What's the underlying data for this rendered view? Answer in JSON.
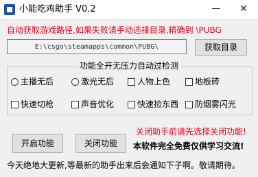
{
  "window": {
    "title": "小能吃鸡助手 V0.2",
    "minimize_glyph": "—",
    "close_glyph": "✕",
    "icon": "app-icon"
  },
  "hint_text": "自动获取游戏路径,如果失败请手动选择目录,精确到 \\PUBG",
  "path": {
    "value": "E:\\csgo\\steamapps\\common\\PUBG\\"
  },
  "buttons": {
    "get_dir": "获取目录",
    "start": "开启功能",
    "stop": "关闭功能"
  },
  "options_title": "功能全开无压力自动过检测",
  "options": {
    "row1": [
      {
        "label": "主播无后",
        "type": "radio",
        "checked": false
      },
      {
        "label": "激光无后",
        "type": "radio",
        "checked": false
      },
      {
        "label": "人物上色",
        "type": "checkbox",
        "checked": false
      },
      {
        "label": "地板砖",
        "type": "checkbox",
        "checked": false
      }
    ],
    "row2": [
      {
        "label": "快速切枪",
        "type": "checkbox",
        "checked": false
      },
      {
        "label": "声音优化",
        "type": "checkbox",
        "checked": false
      },
      {
        "label": "快速捡东西",
        "type": "checkbox",
        "checked": false
      },
      {
        "label": "防烟雾闪光",
        "type": "checkbox",
        "checked": false
      }
    ]
  },
  "warning_text": "关闭助手前请先选择关闭功能!",
  "free_note": "本软件完全免费仅供学习交流!",
  "footer_text": "今天绝地大更新,等最新的助手出来后会通知下子啊。敬请期待。",
  "colors": {
    "warning": "#e8001c",
    "background": "#f0f0f0"
  }
}
